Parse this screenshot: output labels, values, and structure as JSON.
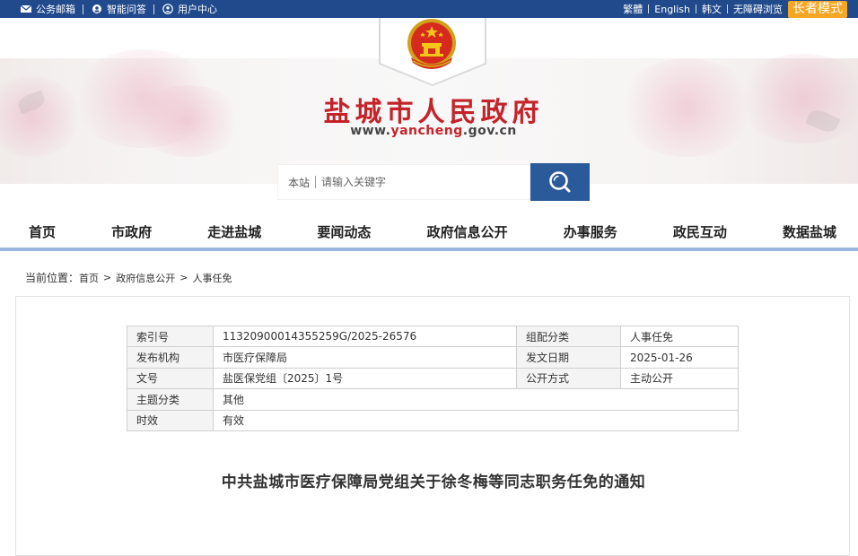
{
  "topbar": {
    "links": [
      {
        "label": "公务邮箱",
        "icon": "mail-icon"
      },
      {
        "label": "智能问答",
        "icon": "chat-icon"
      },
      {
        "label": "用户中心",
        "icon": "user-icon"
      }
    ],
    "right": {
      "traditional": "繁體",
      "english": "English",
      "korean": "韩文",
      "accessible": "无障碍浏览",
      "elder_mode": "长者模式"
    }
  },
  "header": {
    "title": "盐城市人民政府",
    "url_prefix": "www.",
    "url_mid": "yancheng",
    "url_suffix": ".gov.cn"
  },
  "search": {
    "scope": "本站",
    "placeholder": "请输入关键字"
  },
  "nav": [
    "首页",
    "市政府",
    "走进盐城",
    "要闻动态",
    "政府信息公开",
    "办事服务",
    "政民互动",
    "数据盐城"
  ],
  "breadcrumb": {
    "label": "当前位置：",
    "items": [
      "首页",
      "政府信息公开",
      "人事任免"
    ],
    "separator": ">"
  },
  "meta": {
    "index_label": "索引号",
    "index_value": "11320900014355259G/2025-26576",
    "category_label": "组配分类",
    "category_value": "人事任免",
    "publisher_label": "发布机构",
    "publisher_value": "市医疗保障局",
    "date_label": "发文日期",
    "date_value": "2025-01-26",
    "docno_label": "文号",
    "docno_value": "盐医保党组〔2025〕1号",
    "method_label": "公开方式",
    "method_value": "主动公开",
    "topic_label": "主题分类",
    "topic_value": "其他",
    "validity_label": "时效",
    "validity_value": "有效"
  },
  "doc": {
    "title": "中共盐城市医疗保障局党组关于徐冬梅等同志职务任免的通知"
  },
  "colors": {
    "topbar": "#214a8d",
    "brand_red": "#c4232a",
    "search_button": "#2b5a9a",
    "elder_button": "#f5a623",
    "nav_underline": "#9ab7e0"
  }
}
